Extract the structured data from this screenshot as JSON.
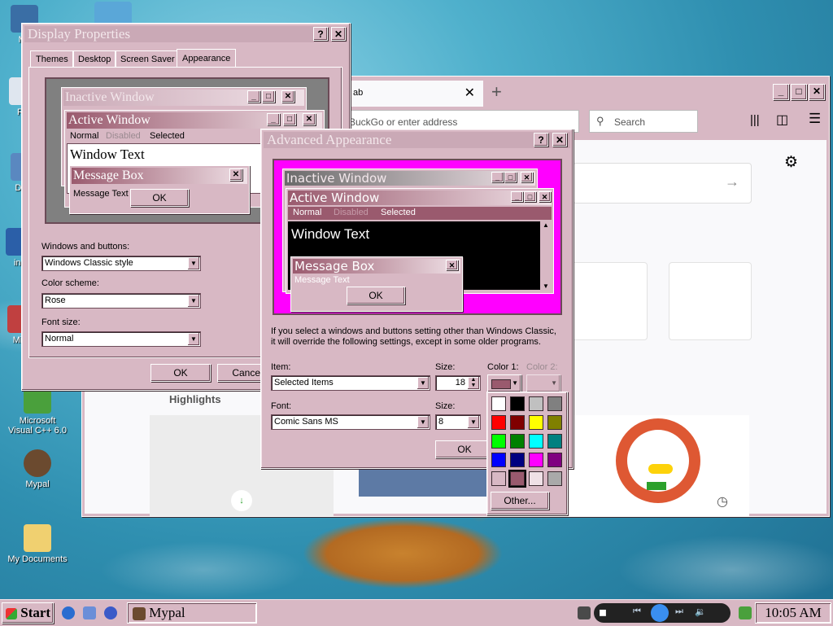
{
  "desktop": {
    "icons": [
      {
        "label": "My",
        "color": "#3a6ea5"
      },
      {
        "label": "Re",
        "color": "#dfe6ef"
      },
      {
        "label": "Data",
        "color": "#5a88c0"
      },
      {
        "label": "ins",
        "color": "#2b5fa8"
      },
      {
        "label": "Micr",
        "color": "#c04040"
      },
      {
        "label": "Microsoft Visual C++ 6.0",
        "color": "#4aa03c"
      },
      {
        "label": "Mypal",
        "color": "#6b4a2f"
      },
      {
        "label": "My Documents",
        "color": "#f0d070"
      }
    ]
  },
  "browser": {
    "tab_label": "ab",
    "address_placeholder": "BuckGo or enter address",
    "search_placeholder": "Search",
    "highlights_label": "Highlights"
  },
  "display_properties": {
    "title": "Display Properties",
    "tabs": [
      "Themes",
      "Desktop",
      "Screen Saver",
      "Appearance"
    ],
    "preview": {
      "inactive_title": "Inactive Window",
      "active_title": "Active Window",
      "menu_normal": "Normal",
      "menu_disabled": "Disabled",
      "menu_selected": "Selected",
      "window_text": "Window Text",
      "message_box_title": "Message Box",
      "message_text": "Message Text",
      "ok": "OK"
    },
    "windows_buttons_label": "Windows and buttons:",
    "windows_buttons_value": "Windows Classic style",
    "color_scheme_label": "Color scheme:",
    "color_scheme_value": "Rose",
    "font_size_label": "Font size:",
    "font_size_value": "Normal",
    "ok": "OK",
    "cancel": "Cancel"
  },
  "advanced": {
    "title": "Advanced Appearance",
    "preview": {
      "inactive_title": "Inactive Window",
      "active_title": "Active Window",
      "menu_normal": "Normal",
      "menu_disabled": "Disabled",
      "menu_selected": "Selected",
      "window_text": "Window Text",
      "message_box_title": "Message Box",
      "message_text": "Message Text",
      "ok": "OK"
    },
    "info_line1": "If you select a windows and buttons setting other than Windows Classic,",
    "info_line2": "it will override the following settings, except in some older programs.",
    "item_label": "Item:",
    "item_value": "Selected Items",
    "size_label": "Size:",
    "item_size_value": "18",
    "color1_label": "Color 1:",
    "color2_label": "Color 2:",
    "font_label": "Font:",
    "font_value": "Comic Sans MS",
    "font_size_label": "Size:",
    "font_size_value": "8",
    "ok": "OK",
    "color1_value": "#9a5a6e"
  },
  "palette": {
    "colors": [
      "#ffffff",
      "#000000",
      "#c0c0c0",
      "#808080",
      "#ff0000",
      "#800000",
      "#ffff00",
      "#808000",
      "#00ff00",
      "#008000",
      "#00ffff",
      "#008080",
      "#0000ff",
      "#000080",
      "#ff00ff",
      "#800080",
      "#d8b8c4",
      "#9a5a6e",
      "#efe0e6",
      "#a9a9a9"
    ],
    "other_label": "Other..."
  },
  "taskbar": {
    "start_label": "Start",
    "task_label": "Mypal",
    "clock": "10:05 AM"
  },
  "colors": {
    "face": "#d8b8c4",
    "active_title": "#9a5a6e",
    "magenta": "#ff00ff"
  }
}
